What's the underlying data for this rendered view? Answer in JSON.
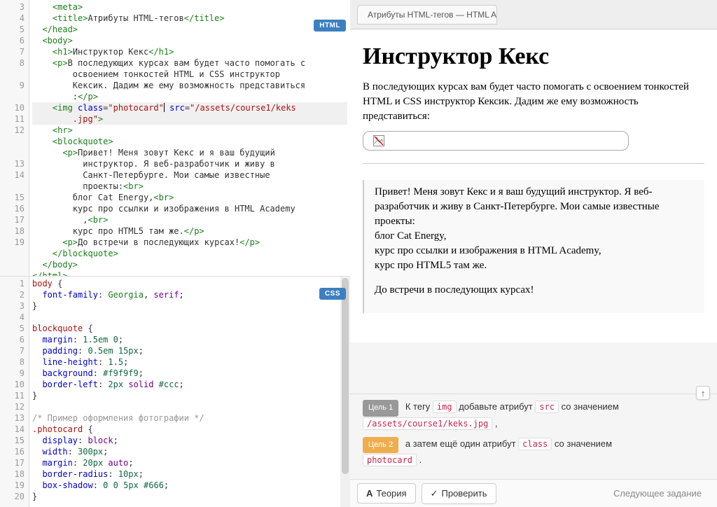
{
  "editors": {
    "html": {
      "badge": "HTML",
      "lines": [
        3,
        4,
        5,
        6,
        7,
        8,
        "",
        9,
        "",
        10,
        11,
        12,
        "",
        "",
        13,
        14,
        "",
        15,
        16,
        17,
        18,
        19
      ],
      "code": [
        {
          "i": "    ",
          "t": [
            {
              "c": "cm-tag",
              "s": "<meta>"
            }
          ]
        },
        {
          "i": "    ",
          "t": [
            {
              "c": "cm-tag",
              "s": "<title>"
            },
            {
              "s": "Атрибуты HTML-тегов"
            },
            {
              "c": "cm-tag",
              "s": "</title>"
            }
          ]
        },
        {
          "i": "  ",
          "t": [
            {
              "c": "cm-tag",
              "s": "</head>"
            }
          ]
        },
        {
          "i": "  ",
          "t": [
            {
              "c": "cm-tag",
              "s": "<body>"
            }
          ]
        },
        {
          "i": "    ",
          "t": [
            {
              "c": "cm-tag",
              "s": "<h1>"
            },
            {
              "s": "Инструктор Кекс"
            },
            {
              "c": "cm-tag",
              "s": "</h1>"
            }
          ]
        },
        {
          "i": "    ",
          "t": [
            {
              "c": "cm-tag",
              "s": "<p>"
            },
            {
              "s": "В последующих курсах вам будет часто помогать с"
            }
          ]
        },
        {
          "i": "        ",
          "t": [
            {
              "s": "освоением тонкостей HTML и CSS инструктор "
            }
          ]
        },
        {
          "i": "        ",
          "t": [
            {
              "s": "Кексик. Дадим же ему возможность представиться"
            }
          ]
        },
        {
          "i": "        ",
          "t": [
            {
              "s": ":"
            },
            {
              "c": "cm-tag",
              "s": "</p>"
            }
          ]
        },
        {
          "i": "    ",
          "active": true,
          "t": [
            {
              "c": "cm-tag",
              "s": "<img"
            },
            {
              "s": " "
            },
            {
              "c": "cm-attr",
              "s": "class"
            },
            {
              "s": "="
            },
            {
              "c": "cm-string",
              "s": "\"photocard\""
            },
            {
              "cur": true
            },
            {
              "s": " "
            },
            {
              "c": "cm-attr",
              "s": "src"
            },
            {
              "s": "="
            },
            {
              "c": "cm-string",
              "s": "\"/assets/course1/keks"
            }
          ]
        },
        {
          "i": "        ",
          "active": true,
          "t": [
            {
              "c": "cm-string",
              "s": ".jpg\""
            },
            {
              "c": "cm-tag",
              "s": ">"
            }
          ]
        },
        {
          "i": "    ",
          "t": [
            {
              "c": "cm-tag",
              "s": "<hr>"
            }
          ]
        },
        {
          "i": "    ",
          "t": [
            {
              "c": "cm-tag",
              "s": "<blockquote>"
            }
          ]
        },
        {
          "i": "      ",
          "t": [
            {
              "c": "cm-tag",
              "s": "<p>"
            },
            {
              "s": "Привет! Меня зовут Кекс и я ваш будущий "
            }
          ]
        },
        {
          "i": "          ",
          "t": [
            {
              "s": "инструктор. Я веб-разработчик и живу в "
            }
          ]
        },
        {
          "i": "          ",
          "t": [
            {
              "s": "Санкт-Петербурге. Мои самые известные "
            }
          ]
        },
        {
          "i": "          ",
          "t": [
            {
              "s": "проекты:"
            },
            {
              "c": "cm-tag",
              "s": "<br>"
            }
          ]
        },
        {
          "i": "        ",
          "t": [
            {
              "s": "блог Cat Energy,"
            },
            {
              "c": "cm-tag",
              "s": "<br>"
            }
          ]
        },
        {
          "i": "        ",
          "t": [
            {
              "s": "курс про ссылки и изображения в HTML Academy"
            }
          ]
        },
        {
          "i": "          ",
          "t": [
            {
              "s": ","
            },
            {
              "c": "cm-tag",
              "s": "<br>"
            }
          ]
        },
        {
          "i": "        ",
          "t": [
            {
              "s": "курс про HTML5 там же."
            },
            {
              "c": "cm-tag",
              "s": "</p>"
            }
          ]
        },
        {
          "i": "      ",
          "t": [
            {
              "c": "cm-tag",
              "s": "<p>"
            },
            {
              "s": "До встречи в последующих курсах!"
            },
            {
              "c": "cm-tag",
              "s": "</p>"
            }
          ]
        },
        {
          "i": "    ",
          "t": [
            {
              "c": "cm-tag",
              "s": "</blockquote>"
            }
          ]
        },
        {
          "i": "  ",
          "t": [
            {
              "c": "cm-tag",
              "s": "</body>"
            }
          ]
        },
        {
          "i": "",
          "t": [
            {
              "c": "cm-tag",
              "s": "</html>"
            }
          ]
        }
      ]
    },
    "css": {
      "badge": "CSS",
      "lines": [
        1,
        2,
        3,
        4,
        5,
        6,
        7,
        8,
        9,
        10,
        11,
        12,
        13,
        14,
        15,
        16,
        17,
        18,
        19,
        20
      ],
      "code": [
        {
          "t": [
            {
              "c": "cm-selector",
              "s": "body"
            },
            {
              "s": " {"
            }
          ]
        },
        {
          "i": "  ",
          "t": [
            {
              "c": "cm-prop",
              "s": "font-family"
            },
            {
              "s": ": "
            },
            {
              "c": "cm-val",
              "s": "Georgia"
            },
            {
              "s": ", "
            },
            {
              "c": "cm-kw",
              "s": "serif"
            },
            {
              "s": ";"
            }
          ]
        },
        {
          "t": [
            {
              "s": "}"
            }
          ]
        },
        {
          "t": []
        },
        {
          "t": [
            {
              "c": "cm-selector",
              "s": "blockquote"
            },
            {
              "s": " {"
            }
          ]
        },
        {
          "i": "  ",
          "t": [
            {
              "c": "cm-prop",
              "s": "margin"
            },
            {
              "s": ": "
            },
            {
              "c": "cm-num",
              "s": "1.5em"
            },
            {
              "s": " "
            },
            {
              "c": "cm-num",
              "s": "0"
            },
            {
              "s": ";"
            }
          ]
        },
        {
          "i": "  ",
          "t": [
            {
              "c": "cm-prop",
              "s": "padding"
            },
            {
              "s": ": "
            },
            {
              "c": "cm-num",
              "s": "0.5em"
            },
            {
              "s": " "
            },
            {
              "c": "cm-num",
              "s": "15px"
            },
            {
              "s": ";"
            }
          ]
        },
        {
          "i": "  ",
          "t": [
            {
              "c": "cm-prop",
              "s": "line-height"
            },
            {
              "s": ": "
            },
            {
              "c": "cm-num",
              "s": "1.5"
            },
            {
              "s": ";"
            }
          ]
        },
        {
          "i": "  ",
          "t": [
            {
              "c": "cm-prop",
              "s": "background"
            },
            {
              "s": ": "
            },
            {
              "c": "cm-num",
              "s": "#f9f9f9"
            },
            {
              "s": ";"
            }
          ]
        },
        {
          "i": "  ",
          "t": [
            {
              "c": "cm-prop",
              "s": "border-left"
            },
            {
              "s": ": "
            },
            {
              "c": "cm-num",
              "s": "2px"
            },
            {
              "s": " "
            },
            {
              "c": "cm-kw",
              "s": "solid"
            },
            {
              "s": " "
            },
            {
              "c": "cm-num",
              "s": "#ccc"
            },
            {
              "s": ";"
            }
          ]
        },
        {
          "t": [
            {
              "s": "}"
            }
          ]
        },
        {
          "t": []
        },
        {
          "t": [
            {
              "c": "cm-comment",
              "s": "/* Пример оформления фотографии */"
            }
          ]
        },
        {
          "t": [
            {
              "c": "cm-selector",
              "s": ".photocard"
            },
            {
              "s": " {"
            }
          ]
        },
        {
          "i": "  ",
          "t": [
            {
              "c": "cm-prop",
              "s": "display"
            },
            {
              "s": ": "
            },
            {
              "c": "cm-kw",
              "s": "block"
            },
            {
              "s": ";"
            }
          ]
        },
        {
          "i": "  ",
          "t": [
            {
              "c": "cm-prop",
              "s": "width"
            },
            {
              "s": ": "
            },
            {
              "c": "cm-num",
              "s": "300px"
            },
            {
              "s": ";"
            }
          ]
        },
        {
          "i": "  ",
          "t": [
            {
              "c": "cm-prop",
              "s": "margin"
            },
            {
              "s": ": "
            },
            {
              "c": "cm-num",
              "s": "20px"
            },
            {
              "s": " "
            },
            {
              "c": "cm-kw",
              "s": "auto"
            },
            {
              "s": ";"
            }
          ]
        },
        {
          "i": "  ",
          "t": [
            {
              "c": "cm-prop",
              "s": "border-radius"
            },
            {
              "s": ": "
            },
            {
              "c": "cm-num",
              "s": "10px"
            },
            {
              "s": ";"
            }
          ]
        },
        {
          "i": "  ",
          "t": [
            {
              "c": "cm-prop",
              "s": "box-shadow"
            },
            {
              "s": ": "
            },
            {
              "c": "cm-num",
              "s": "0"
            },
            {
              "s": " "
            },
            {
              "c": "cm-num",
              "s": "0"
            },
            {
              "s": " "
            },
            {
              "c": "cm-num",
              "s": "5px"
            },
            {
              "s": " "
            },
            {
              "c": "cm-num",
              "s": "#666"
            },
            {
              "s": ";"
            }
          ]
        },
        {
          "t": [
            {
              "s": "}"
            }
          ]
        }
      ]
    }
  },
  "preview": {
    "tab": "Атрибуты HTML-тегов — HTML Ac",
    "h1": "Инструктор Кекс",
    "intro": "В последующих курсах вам будет часто помогать с освоением тонкостей HTML и CSS инструктор Кексик. Дадим же ему возможность представиться:",
    "bq1": "Привет! Меня зовут Кекс и я ваш будущий инструктор. Я веб-разработчик и живу в Санкт-Петербурге. Мои самые известные проекты:",
    "bq2": "блог Cat Energy,",
    "bq3": "курс про ссылки и изображения в HTML Academy,",
    "bq4": "курс про HTML5 там же.",
    "bq5": "До встречи в последующих курсах!"
  },
  "goals": {
    "g1_badge": "Цель 1",
    "g1_a": "К тегу ",
    "g1_code1": "img",
    "g1_b": " добавьте атрибут ",
    "g1_code2": "src",
    "g1_c": " со значением ",
    "g1_code3": "/assets/course1/keks.jpg",
    "g1_d": " ,",
    "g2_badge": "Цель 2",
    "g2_a": "а затем ещё один атрибут ",
    "g2_code1": "class",
    "g2_b": " со значением ",
    "g2_code2": "photocard",
    "g2_c": " ."
  },
  "buttons": {
    "theory": "Теория",
    "check": "Проверить",
    "next": "Следующее задание"
  }
}
